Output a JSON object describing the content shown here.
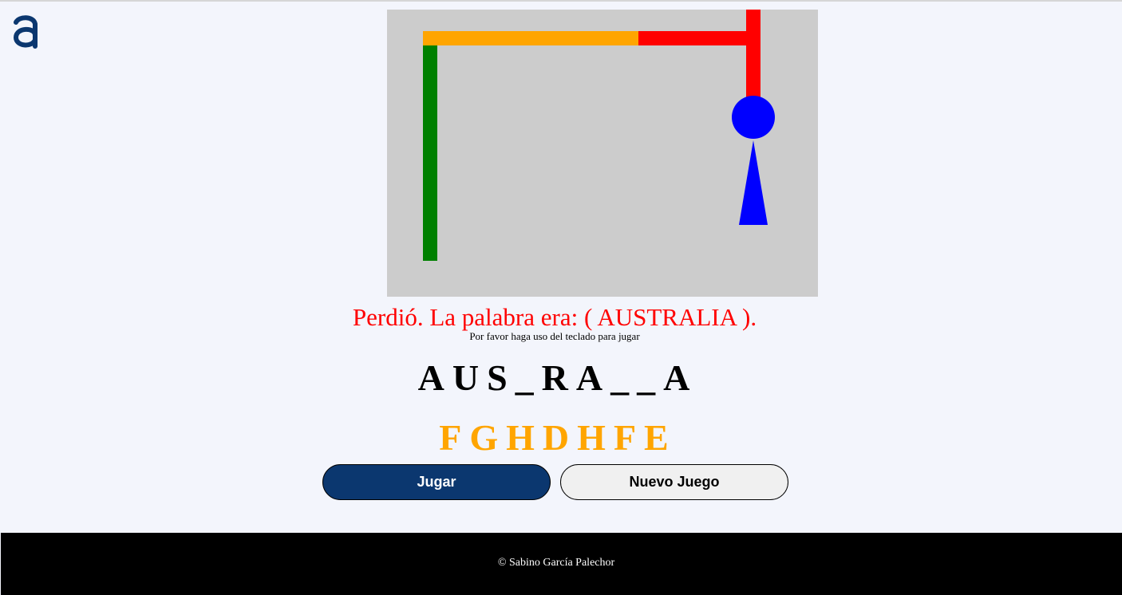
{
  "logo": {
    "icon": "alura-logo-icon",
    "color": "#0b376f"
  },
  "game": {
    "message": "Perdió. La palabra era: ( AUSTRALIA ).",
    "hint": "Por favor haga uso del teclado para jugar",
    "word_display": "AUS_RA__A",
    "wrong_letters": "FGHDHFE",
    "colors": {
      "board": "#cccccc",
      "pole": "#008000",
      "beam_left": "#ffa500",
      "beam_right": "#ff0000",
      "rope": "#ff0000",
      "figure": "#0000ff",
      "message": "#ff0000",
      "wrong_letters": "#ffa500"
    }
  },
  "buttons": {
    "play_label": "Jugar",
    "new_game_label": "Nuevo Juego"
  },
  "footer": {
    "copyright": "© Sabino García Palechor"
  }
}
